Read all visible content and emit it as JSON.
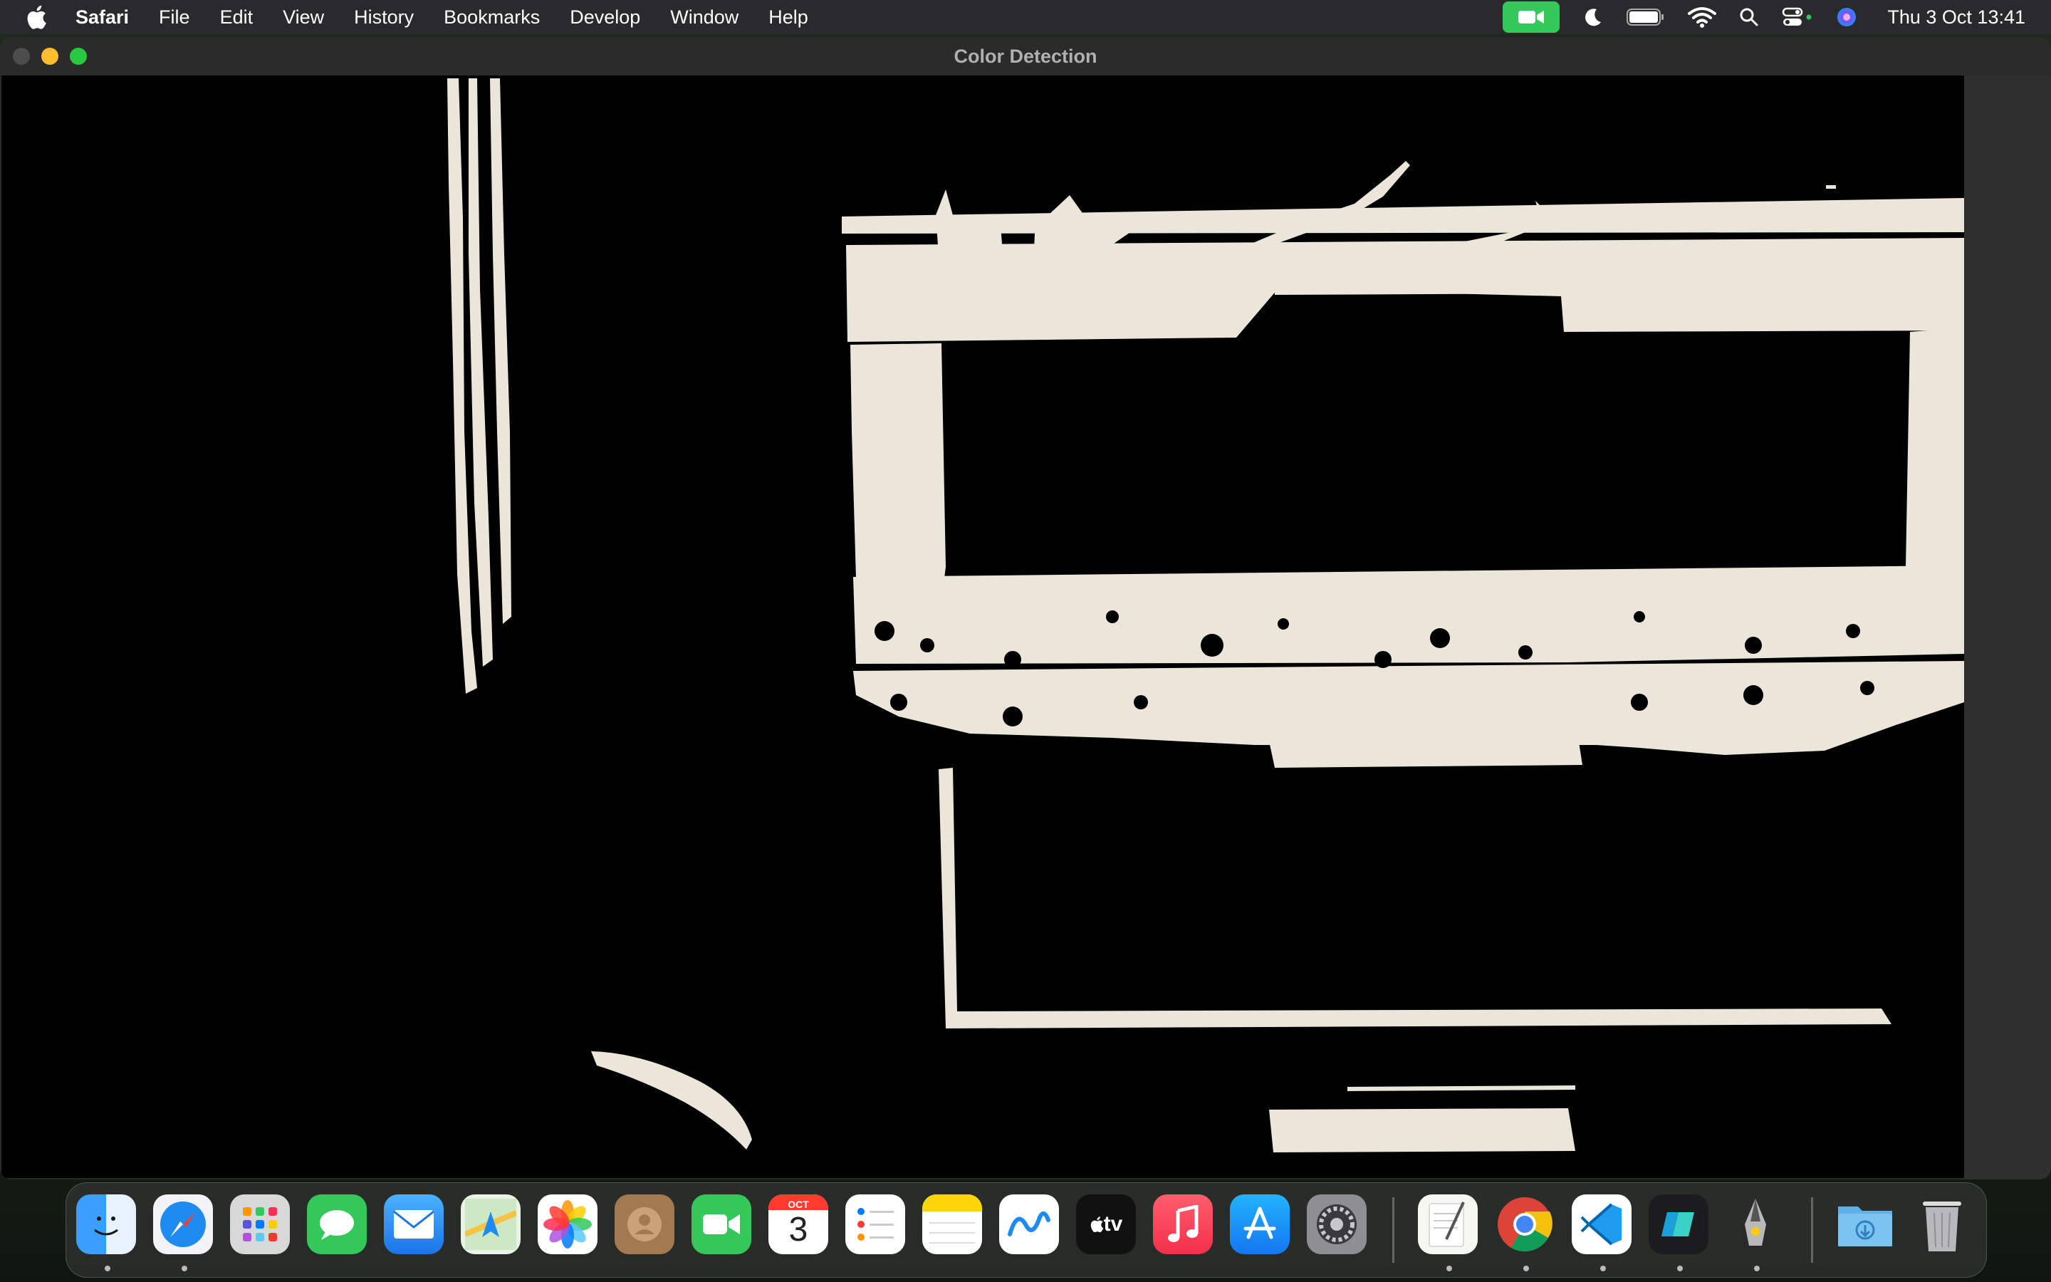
{
  "menubar": {
    "app_name": "Safari",
    "items": [
      "File",
      "Edit",
      "View",
      "History",
      "Bookmarks",
      "Develop",
      "Window",
      "Help"
    ],
    "clock": "Thu 3 Oct  13:41"
  },
  "window": {
    "title": "Color Detection"
  },
  "dock": {
    "calendar_month": "OCT",
    "calendar_day": "3",
    "appletv_label": "tv",
    "apps": [
      "finder",
      "safari",
      "launchpad",
      "messages",
      "mail",
      "maps",
      "photos",
      "contacts",
      "facetime",
      "calendar",
      "reminders",
      "notes",
      "freeform",
      "apple-tv",
      "music",
      "app-store",
      "system-settings",
      "textedit",
      "chrome",
      "vscode",
      "ai-app",
      "scripteditor",
      "downloads",
      "trash"
    ]
  },
  "colors": {
    "menubar": "#2a2a2c",
    "window": "#2b2b2b",
    "mask_white": "#ece6da",
    "mask_black": "#000000",
    "camera_pill": "#34c759"
  }
}
